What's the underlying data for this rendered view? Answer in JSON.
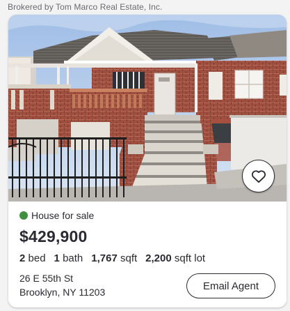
{
  "broker_text": "Brokered by Tom Marco Real Estate, Inc.",
  "listing": {
    "photo_alt": "Brick house with front steps",
    "status": "House for sale",
    "status_color": "#3f8f3f",
    "price": "$429,900",
    "facts": [
      {
        "value": "2",
        "unit": "bed"
      },
      {
        "value": "1",
        "unit": "bath"
      },
      {
        "value": "1,767",
        "unit": "sqft"
      },
      {
        "value": "2,200",
        "unit": "sqft lot"
      }
    ],
    "address_line1": "26 E 55th St",
    "address_line2": "Brooklyn, NY 11203",
    "email_button": "Email Agent",
    "favorite_icon": "heart-outline-icon"
  }
}
